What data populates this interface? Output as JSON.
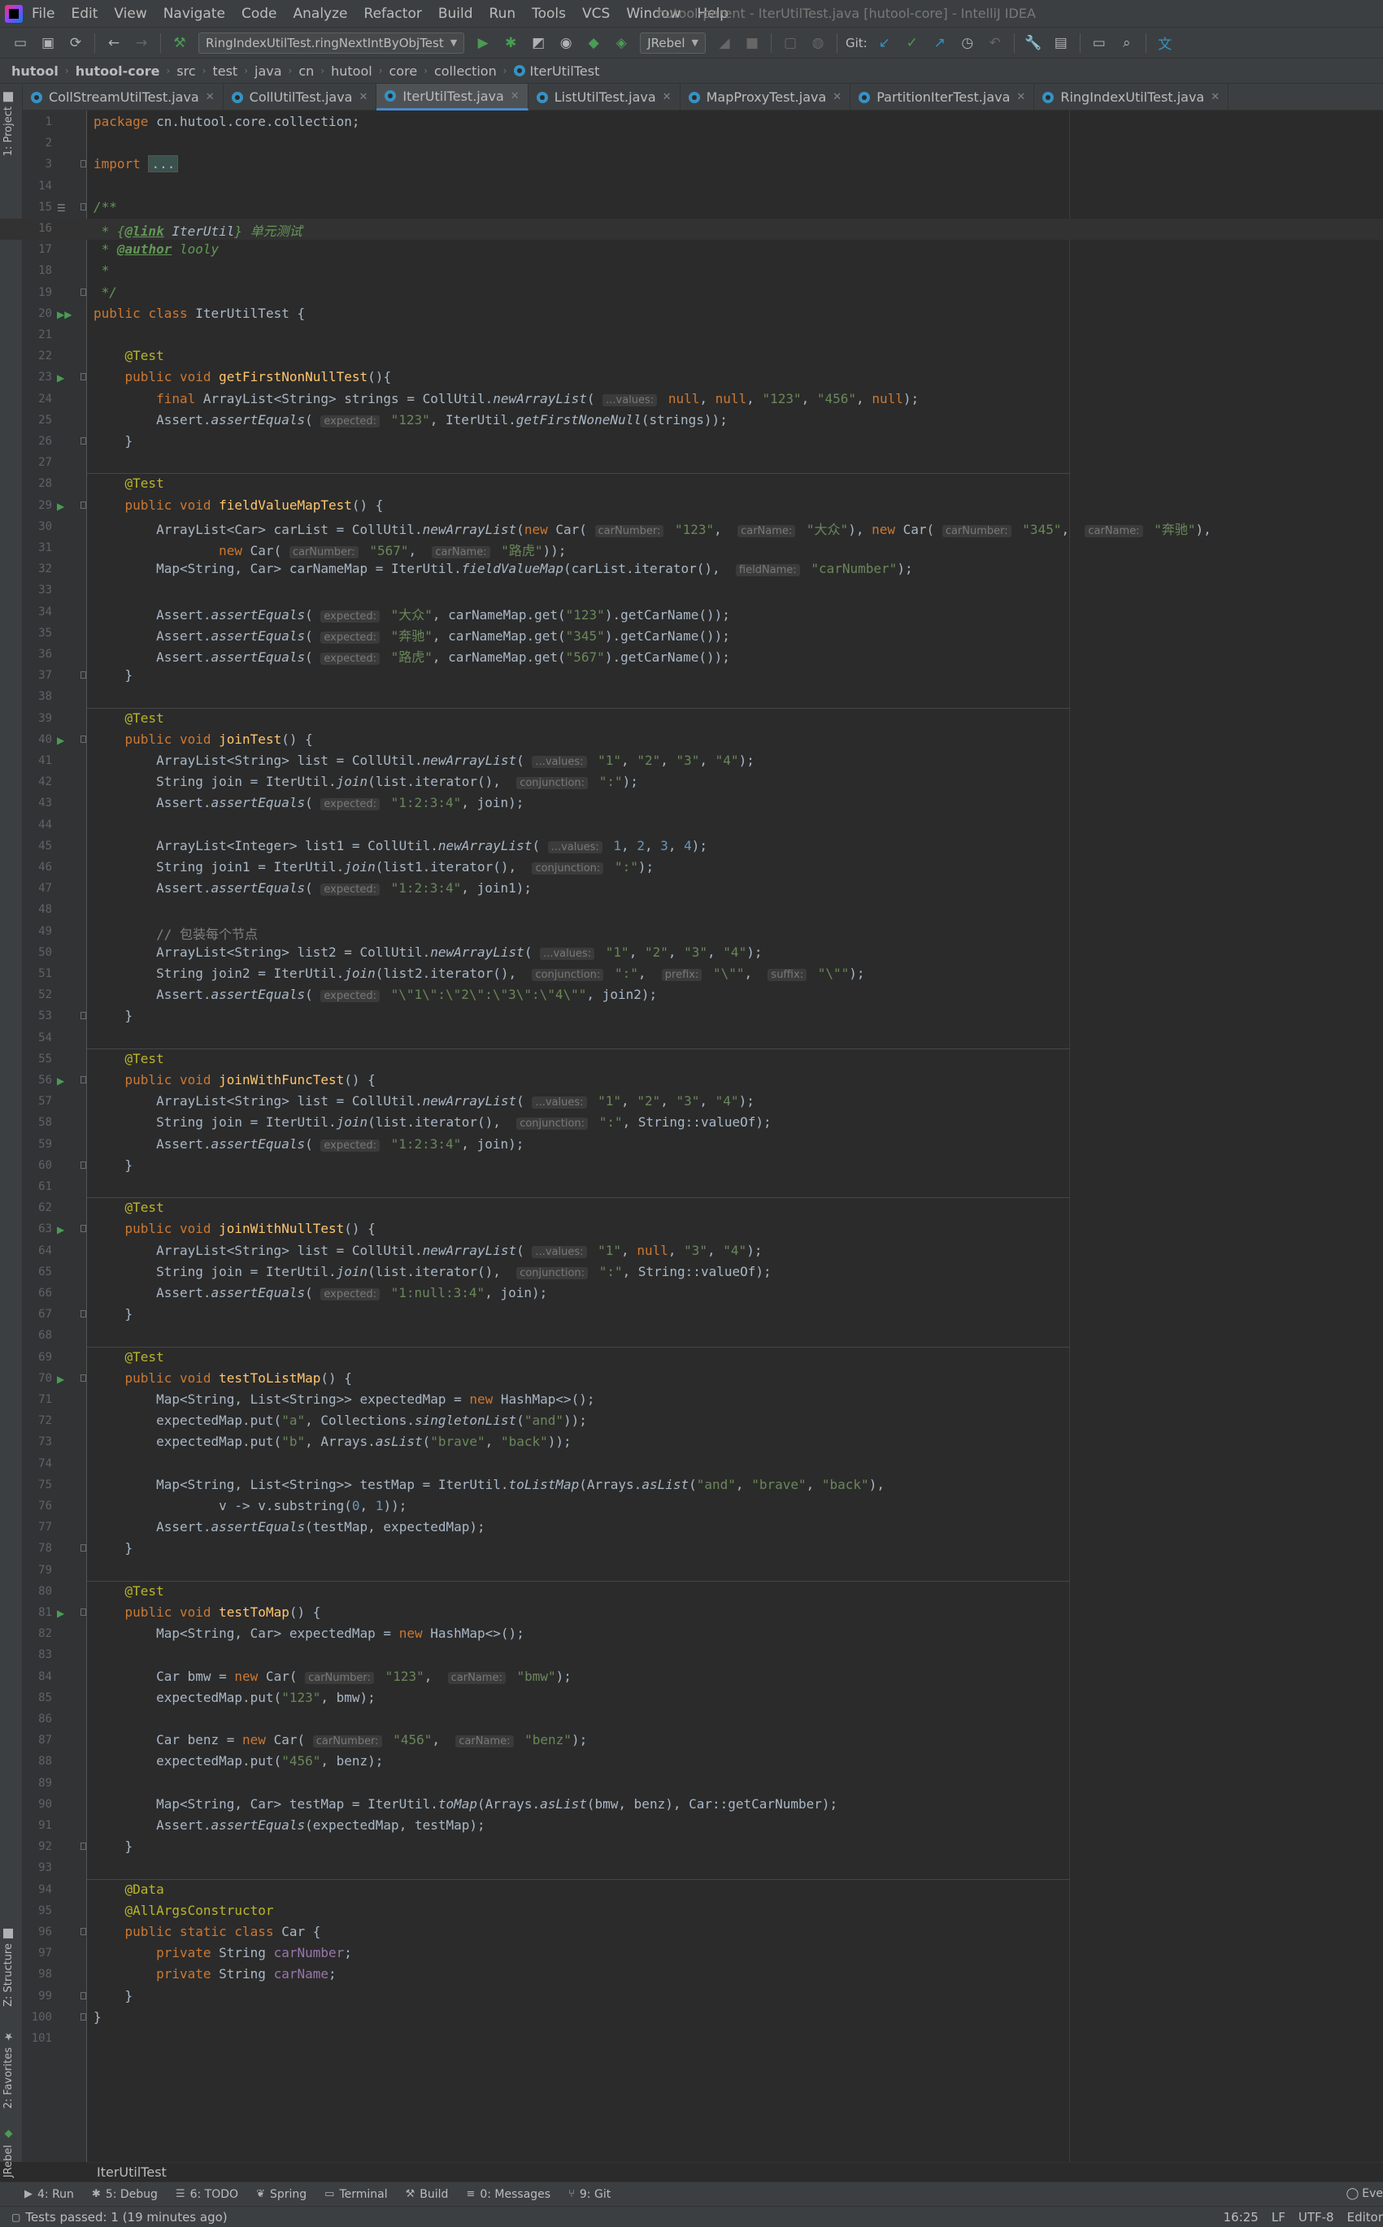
{
  "window": {
    "title": "hutool-parent - IterUtilTest.java [hutool-core] - IntelliJ IDEA"
  },
  "menu": [
    "File",
    "Edit",
    "View",
    "Navigate",
    "Code",
    "Analyze",
    "Refactor",
    "Build",
    "Run",
    "Tools",
    "VCS",
    "Window",
    "Help"
  ],
  "toolbar": {
    "run_config": "RingIndexUtilTest.ringNextIntByObjTest",
    "jrebel": "JRebel",
    "git_label": "Git:"
  },
  "breadcrumbs": [
    "hutool",
    "hutool-core",
    "src",
    "test",
    "java",
    "cn",
    "hutool",
    "core",
    "collection",
    "IterUtilTest"
  ],
  "tabs": [
    {
      "label": "CollStreamUtilTest.java",
      "active": false
    },
    {
      "label": "CollUtilTest.java",
      "active": false
    },
    {
      "label": "IterUtilTest.java",
      "active": true
    },
    {
      "label": "ListUtilTest.java",
      "active": false
    },
    {
      "label": "MapProxyTest.java",
      "active": false
    },
    {
      "label": "PartitionIterTest.java",
      "active": false
    },
    {
      "label": "RingIndexUtilTest.java",
      "active": false
    }
  ],
  "left_stripe": [
    "1: Project",
    "Z: Structure",
    "2: Favorites",
    "JRebel"
  ],
  "code_lines": [
    {
      "n": "1",
      "t": "package cn.hutool.core.collection;"
    },
    {
      "n": "2",
      "t": ""
    },
    {
      "n": "3",
      "t": "import ..."
    },
    {
      "n": "14",
      "t": ""
    },
    {
      "n": "15",
      "t": "/**"
    },
    {
      "n": "16",
      "t": " * {@link IterUtil} 单元测试"
    },
    {
      "n": "17",
      "t": " * @author looly"
    },
    {
      "n": "18",
      "t": " *"
    },
    {
      "n": "19",
      "t": " */"
    },
    {
      "n": "20",
      "t": "public class IterUtilTest {"
    },
    {
      "n": "21",
      "t": ""
    },
    {
      "n": "22",
      "t": "    @Test"
    },
    {
      "n": "23",
      "t": "    public void getFirstNonNullTest(){"
    },
    {
      "n": "24",
      "t": "        final ArrayList<String> strings = CollUtil.newArrayList( ...values: null, null, \"123\", \"456\", null);"
    },
    {
      "n": "25",
      "t": "        Assert.assertEquals( expected: \"123\", IterUtil.getFirstNoneNull(strings));"
    },
    {
      "n": "26",
      "t": "    }"
    },
    {
      "n": "27",
      "t": ""
    },
    {
      "n": "28",
      "t": "    @Test"
    },
    {
      "n": "29",
      "t": "    public void fieldValueMapTest() {"
    },
    {
      "n": "30",
      "t": "        ArrayList<Car> carList = CollUtil.newArrayList(new Car( carNumber: \"123\",  carName: \"大众\"), new Car( carNumber: \"345\",  carName: \"奔驰\"),"
    },
    {
      "n": "31",
      "t": "                new Car( carNumber: \"567\",  carName: \"路虎\"));"
    },
    {
      "n": "32",
      "t": "        Map<String, Car> carNameMap = IterUtil.fieldValueMap(carList.iterator(),  fieldName: \"carNumber\");"
    },
    {
      "n": "33",
      "t": ""
    },
    {
      "n": "34",
      "t": "        Assert.assertEquals( expected: \"大众\", carNameMap.get(\"123\").getCarName());"
    },
    {
      "n": "35",
      "t": "        Assert.assertEquals( expected: \"奔驰\", carNameMap.get(\"345\").getCarName());"
    },
    {
      "n": "36",
      "t": "        Assert.assertEquals( expected: \"路虎\", carNameMap.get(\"567\").getCarName());"
    },
    {
      "n": "37",
      "t": "    }"
    },
    {
      "n": "38",
      "t": ""
    },
    {
      "n": "39",
      "t": "    @Test"
    },
    {
      "n": "40",
      "t": "    public void joinTest() {"
    },
    {
      "n": "41",
      "t": "        ArrayList<String> list = CollUtil.newArrayList( ...values: \"1\", \"2\", \"3\", \"4\");"
    },
    {
      "n": "42",
      "t": "        String join = IterUtil.join(list.iterator(),  conjunction: \":\");"
    },
    {
      "n": "43",
      "t": "        Assert.assertEquals( expected: \"1:2:3:4\", join);"
    },
    {
      "n": "44",
      "t": ""
    },
    {
      "n": "45",
      "t": "        ArrayList<Integer> list1 = CollUtil.newArrayList( ...values: 1, 2, 3, 4);"
    },
    {
      "n": "46",
      "t": "        String join1 = IterUtil.join(list1.iterator(),  conjunction: \":\");"
    },
    {
      "n": "47",
      "t": "        Assert.assertEquals( expected: \"1:2:3:4\", join1);"
    },
    {
      "n": "48",
      "t": ""
    },
    {
      "n": "49",
      "t": "        // 包装每个节点"
    },
    {
      "n": "50",
      "t": "        ArrayList<String> list2 = CollUtil.newArrayList( ...values: \"1\", \"2\", \"3\", \"4\");"
    },
    {
      "n": "51",
      "t": "        String join2 = IterUtil.join(list2.iterator(),  conjunction: \":\",  prefix: \"\\\"\",  suffix: \"\\\"\");"
    },
    {
      "n": "52",
      "t": "        Assert.assertEquals( expected: \"\\\"1\\\":\\\"2\\\":\\\"3\\\":\\\"4\\\"\", join2);"
    },
    {
      "n": "53",
      "t": "    }"
    },
    {
      "n": "54",
      "t": ""
    },
    {
      "n": "55",
      "t": "    @Test"
    },
    {
      "n": "56",
      "t": "    public void joinWithFuncTest() {"
    },
    {
      "n": "57",
      "t": "        ArrayList<String> list = CollUtil.newArrayList( ...values: \"1\", \"2\", \"3\", \"4\");"
    },
    {
      "n": "58",
      "t": "        String join = IterUtil.join(list.iterator(),  conjunction: \":\", String::valueOf);"
    },
    {
      "n": "59",
      "t": "        Assert.assertEquals( expected: \"1:2:3:4\", join);"
    },
    {
      "n": "60",
      "t": "    }"
    },
    {
      "n": "61",
      "t": ""
    },
    {
      "n": "62",
      "t": "    @Test"
    },
    {
      "n": "63",
      "t": "    public void joinWithNullTest() {"
    },
    {
      "n": "64",
      "t": "        ArrayList<String> list = CollUtil.newArrayList( ...values: \"1\", null, \"3\", \"4\");"
    },
    {
      "n": "65",
      "t": "        String join = IterUtil.join(list.iterator(),  conjunction: \":\", String::valueOf);"
    },
    {
      "n": "66",
      "t": "        Assert.assertEquals( expected: \"1:null:3:4\", join);"
    },
    {
      "n": "67",
      "t": "    }"
    },
    {
      "n": "68",
      "t": ""
    },
    {
      "n": "69",
      "t": "    @Test"
    },
    {
      "n": "70",
      "t": "    public void testToListMap() {"
    },
    {
      "n": "71",
      "t": "        Map<String, List<String>> expectedMap = new HashMap<>();"
    },
    {
      "n": "72",
      "t": "        expectedMap.put(\"a\", Collections.singletonList(\"and\"));"
    },
    {
      "n": "73",
      "t": "        expectedMap.put(\"b\", Arrays.asList(\"brave\", \"back\"));"
    },
    {
      "n": "74",
      "t": ""
    },
    {
      "n": "75",
      "t": "        Map<String, List<String>> testMap = IterUtil.toListMap(Arrays.asList(\"and\", \"brave\", \"back\"),"
    },
    {
      "n": "76",
      "t": "                v -> v.substring(0, 1));"
    },
    {
      "n": "77",
      "t": "        Assert.assertEquals(testMap, expectedMap);"
    },
    {
      "n": "78",
      "t": "    }"
    },
    {
      "n": "79",
      "t": ""
    },
    {
      "n": "80",
      "t": "    @Test"
    },
    {
      "n": "81",
      "t": "    public void testToMap() {"
    },
    {
      "n": "82",
      "t": "        Map<String, Car> expectedMap = new HashMap<>();"
    },
    {
      "n": "83",
      "t": ""
    },
    {
      "n": "84",
      "t": "        Car bmw = new Car( carNumber: \"123\",  carName: \"bmw\");"
    },
    {
      "n": "85",
      "t": "        expectedMap.put(\"123\", bmw);"
    },
    {
      "n": "86",
      "t": ""
    },
    {
      "n": "87",
      "t": "        Car benz = new Car( carNumber: \"456\",  carName: \"benz\");"
    },
    {
      "n": "88",
      "t": "        expectedMap.put(\"456\", benz);"
    },
    {
      "n": "89",
      "t": ""
    },
    {
      "n": "90",
      "t": "        Map<String, Car> testMap = IterUtil.toMap(Arrays.asList(bmw, benz), Car::getCarNumber);"
    },
    {
      "n": "91",
      "t": "        Assert.assertEquals(expectedMap, testMap);"
    },
    {
      "n": "92",
      "t": "    }"
    },
    {
      "n": "93",
      "t": ""
    },
    {
      "n": "94",
      "t": "    @Data"
    },
    {
      "n": "95",
      "t": "    @AllArgsConstructor"
    },
    {
      "n": "96",
      "t": "    public static class Car {"
    },
    {
      "n": "97",
      "t": "        private String carNumber;"
    },
    {
      "n": "98",
      "t": "        private String carName;"
    },
    {
      "n": "99",
      "t": "    }"
    },
    {
      "n": "100",
      "t": "}"
    },
    {
      "n": "101",
      "t": ""
    }
  ],
  "editor_breadcrumb": "IterUtilTest",
  "tool_windows": [
    {
      "icon": "play-icon",
      "label": "4: Run"
    },
    {
      "icon": "bug-icon",
      "label": "5: Debug"
    },
    {
      "icon": "list-icon",
      "label": "6: TODO"
    },
    {
      "icon": "leaf-icon",
      "label": "Spring"
    },
    {
      "icon": "terminal-icon",
      "label": "Terminal"
    },
    {
      "icon": "hammer-icon",
      "label": "Build"
    },
    {
      "icon": "messages-icon",
      "label": "0: Messages"
    },
    {
      "icon": "git-icon",
      "label": "9: Git"
    }
  ],
  "event_log": "Eve",
  "status": {
    "message": "Tests passed: 1 (19 minutes ago)",
    "position": "16:25",
    "line_sep": "LF",
    "encoding": "UTF-8",
    "editor_cfg": "Editor"
  },
  "colors": {
    "background": "#2b2b2b",
    "keyword": "#cc7832",
    "string": "#6a8759",
    "number": "#6897bb",
    "annotation": "#bbb529",
    "method": "#ffc66d"
  }
}
